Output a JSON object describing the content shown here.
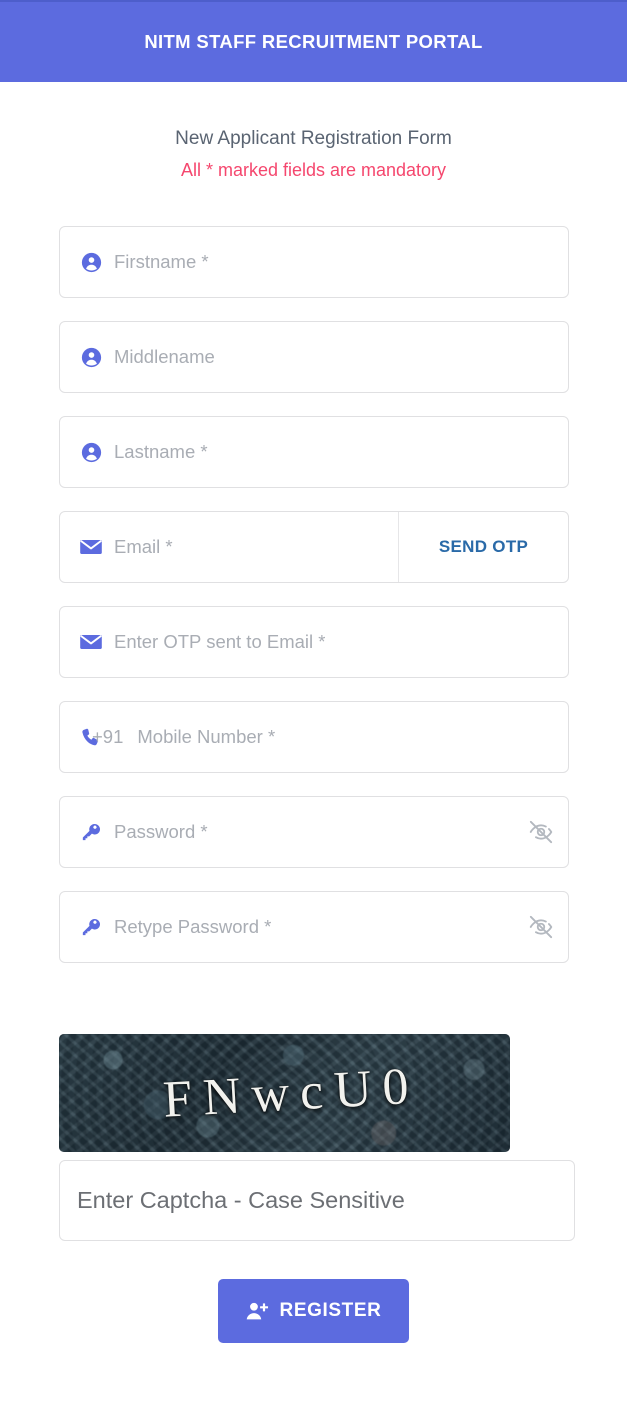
{
  "header": {
    "title": "NITM STAFF RECRUITMENT PORTAL",
    "background_color": "#5c6bdf"
  },
  "intro": {
    "title": "New Applicant Registration Form",
    "mandatory_note": "All * marked fields are mandatory",
    "note_color": "#f5476e"
  },
  "form": {
    "fields": [
      {
        "name": "firstname",
        "placeholder": "Firstname *",
        "icon": "person-icon",
        "required": true
      },
      {
        "name": "middlename",
        "placeholder": "Middlename",
        "icon": "person-icon",
        "required": false
      },
      {
        "name": "lastname",
        "placeholder": "Lastname *",
        "icon": "person-icon",
        "required": true
      },
      {
        "name": "email",
        "placeholder": "Email *",
        "icon": "envelope-icon",
        "required": true
      },
      {
        "name": "otp",
        "placeholder": "Enter OTP sent to Email *",
        "icon": "envelope-icon",
        "required": true
      },
      {
        "name": "mobile",
        "placeholder": "Mobile Number *",
        "icon": "phone-icon",
        "prefix": "+91",
        "required": true
      },
      {
        "name": "password",
        "placeholder": "Password *",
        "icon": "key-icon",
        "required": true
      },
      {
        "name": "retype_password",
        "placeholder": "Retype Password *",
        "icon": "key-icon",
        "required": true
      }
    ],
    "send_otp_label": "SEND OTP",
    "send_otp_color": "#2a6aa8",
    "icon_color": "#5c6bdf",
    "placeholder_color": "#a9adb4",
    "eye_toggle_icon": "eye-off-icon"
  },
  "captcha": {
    "image_text": "FNwcU0",
    "input_placeholder": "Enter Captcha - Case Sensitive"
  },
  "submit": {
    "label": "REGISTER",
    "icon": "person-add-icon",
    "background_color": "#5c6bdf"
  }
}
